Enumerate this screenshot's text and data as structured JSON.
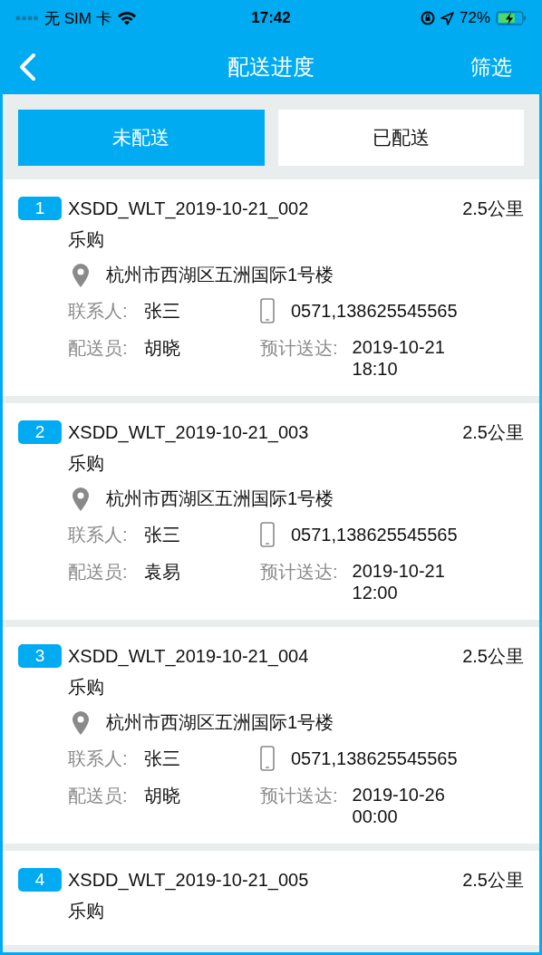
{
  "status_bar": {
    "carrier": "无 SIM 卡",
    "time": "17:42",
    "battery": "72%"
  },
  "nav": {
    "title": "配送进度",
    "action": "筛选"
  },
  "tabs": [
    {
      "label": "未配送",
      "selected": true
    },
    {
      "label": "已配送",
      "selected": false
    }
  ],
  "orders": [
    {
      "index": "1",
      "order_no": "XSDD_WLT_2019-10-21_002",
      "distance": "2.5公里",
      "shop": "乐购",
      "address": "杭州市西湖区五洲国际1号楼",
      "contact_label": "联系人:",
      "contact": "张三",
      "phone": "0571,138625545565",
      "courier_label": "配送员:",
      "courier": "胡晓",
      "eta_label": "预计送达:",
      "eta_date": "2019-10-21",
      "eta_time": "18:10"
    },
    {
      "index": "2",
      "order_no": "XSDD_WLT_2019-10-21_003",
      "distance": "2.5公里",
      "shop": "乐购",
      "address": "杭州市西湖区五洲国际1号楼",
      "contact_label": "联系人:",
      "contact": "张三",
      "phone": "0571,138625545565",
      "courier_label": "配送员:",
      "courier": "袁易",
      "eta_label": "预计送达:",
      "eta_date": "2019-10-21",
      "eta_time": "12:00"
    },
    {
      "index": "3",
      "order_no": "XSDD_WLT_2019-10-21_004",
      "distance": "2.5公里",
      "shop": "乐购",
      "address": "杭州市西湖区五洲国际1号楼",
      "contact_label": "联系人:",
      "contact": "张三",
      "phone": "0571,138625545565",
      "courier_label": "配送员:",
      "courier": "胡晓",
      "eta_label": "预计送达:",
      "eta_date": "2019-10-26",
      "eta_time": "00:00"
    },
    {
      "index": "4",
      "order_no": "XSDD_WLT_2019-10-21_005",
      "distance": "2.5公里",
      "shop": "乐购"
    }
  ]
}
